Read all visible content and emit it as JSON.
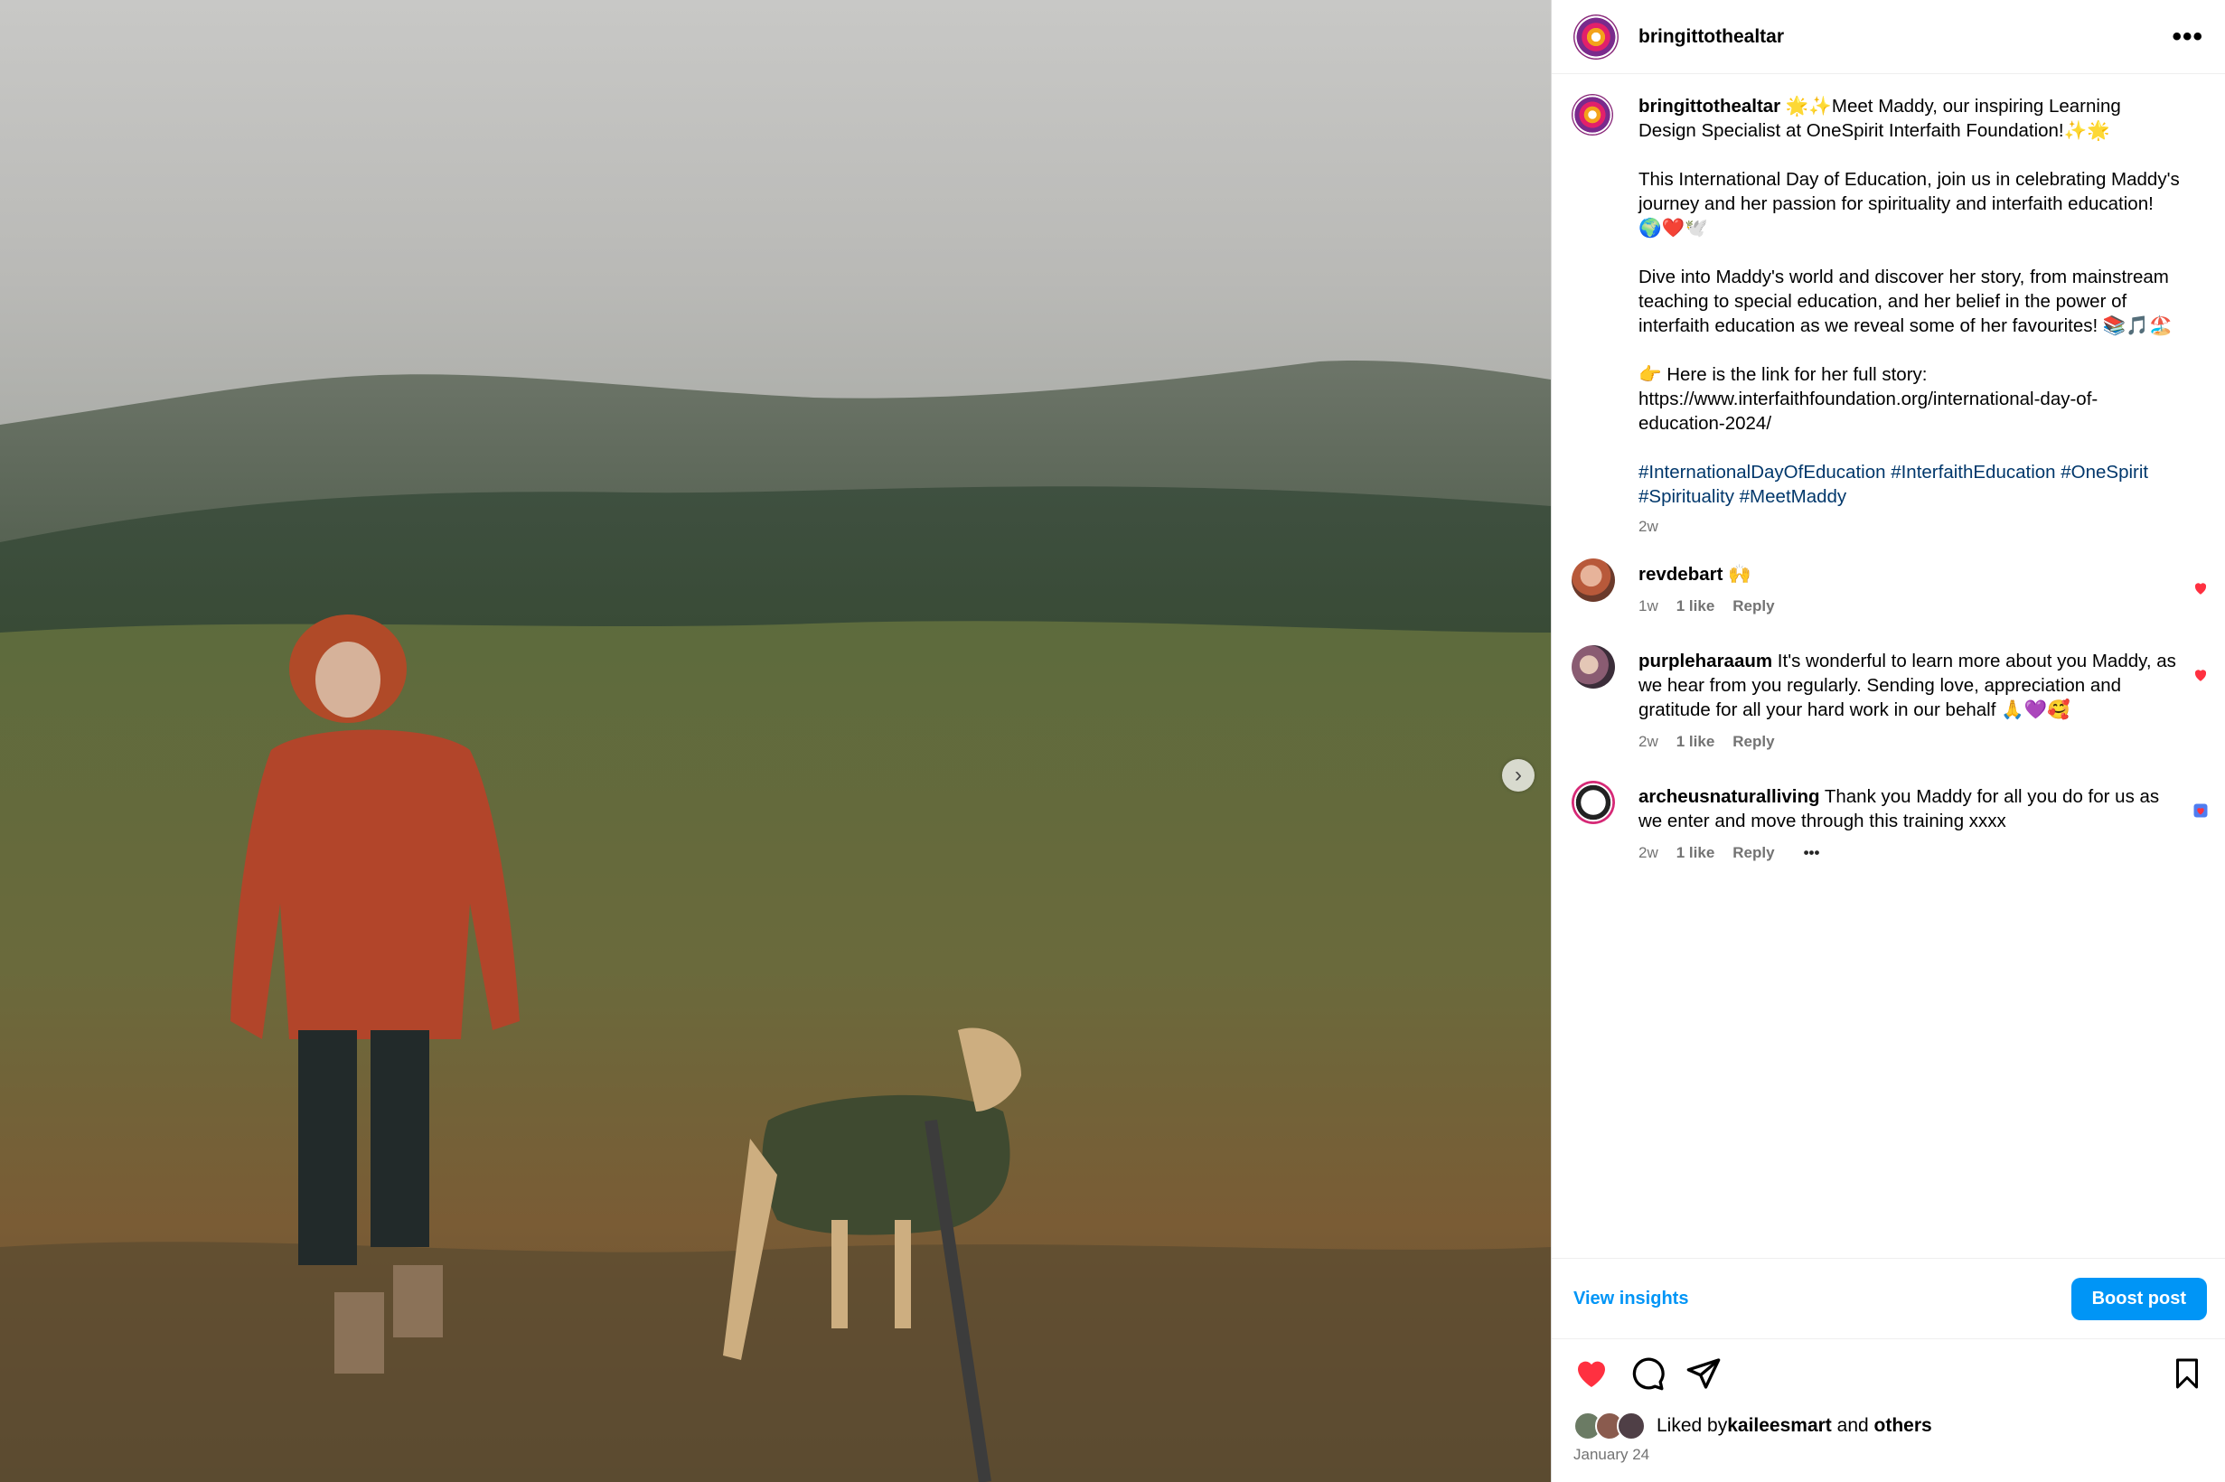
{
  "post": {
    "username": "bringittothealtar",
    "more_label": "•••",
    "caption": {
      "username": "bringittothealtar",
      "paragraphs": [
        "🌟✨Meet Maddy, our inspiring Learning Design Specialist at OneSpirit Interfaith Foundation!✨🌟",
        "This International Day of Education, join us in celebrating Maddy's journey and her passion for spirituality and interfaith education! 🌍❤️🕊️",
        "Dive into Maddy's world and discover her story, from mainstream teaching to special education, and her belief in the power of interfaith education as we reveal some of her favourites! 📚🎵🏖️",
        "👉 Here is the link for her full story:\nhttps://www.interfaithfoundation.org/international-day-of-education-2024/"
      ],
      "hashtags": "#InternationalDayOfEducation #InterfaithEducation #OneSpirit #Spirituality #MeetMaddy",
      "age": "2w"
    },
    "comments": [
      {
        "username": "revdebart",
        "text": " 🙌",
        "age": "1w",
        "likes": "1 like",
        "reply": "Reply"
      },
      {
        "username": "purpleharaaum",
        "text": " It's wonderful to learn more about you Maddy, as we hear from you regularly. Sending love, appreciation and gratitude for all your hard work in our behalf 🙏💜🥰",
        "age": "2w",
        "likes": "1 like",
        "reply": "Reply"
      },
      {
        "username": "archeusnaturalliving",
        "text": " Thank you Maddy for all you do for us as we enter and move through this training xxxx",
        "age": "2w",
        "likes": "1 like",
        "reply": "Reply",
        "more": "•••"
      }
    ],
    "view_insights": "View insights",
    "boost_post": "Boost post",
    "liked_by_prefix": "Liked by ",
    "liked_by_user": "kaileesmart",
    "liked_by_and": " and ",
    "liked_by_others": "others",
    "date": "January 24"
  },
  "colors": {
    "accent": "#0095f6",
    "like_red": "#ff3040",
    "hashtag": "#00376b",
    "muted": "#737373"
  },
  "icons": [
    "next-arrow-icon",
    "more-options-icon",
    "heart-icon",
    "comment-icon",
    "share-icon",
    "bookmark-icon",
    "comment-like-heart-icon"
  ]
}
